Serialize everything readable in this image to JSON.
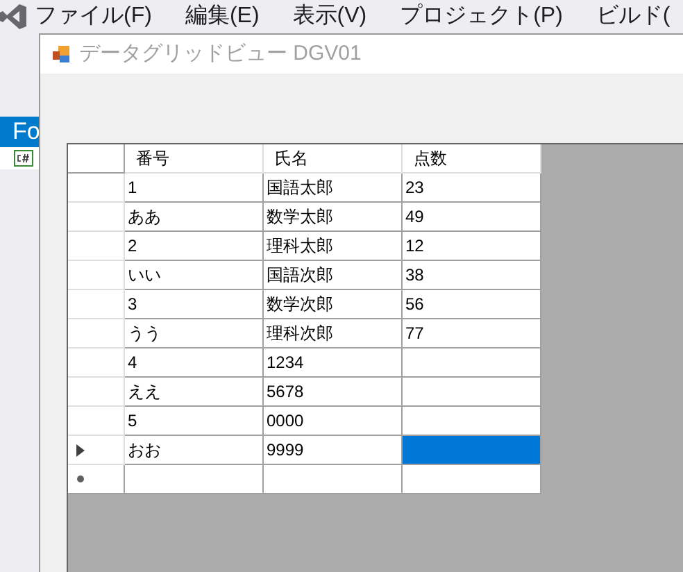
{
  "menu": [
    {
      "label": "ファイル(F)"
    },
    {
      "label": "編集(E)"
    },
    {
      "label": "表示(V)"
    },
    {
      "label": "プロジェクト(P)"
    },
    {
      "label": "ビルド("
    }
  ],
  "side_panel": {
    "tab": "Fo"
  },
  "window": {
    "title": "データグリッドビュー DGV01"
  },
  "grid": {
    "columns": [
      "番号",
      "氏名",
      "点数"
    ],
    "rows": [
      {
        "kind": "data",
        "current": false,
        "cells": [
          {
            "text": "1",
            "selected": false
          },
          {
            "text": "国語太郎",
            "selected": false
          },
          {
            "text": "23",
            "selected": false
          }
        ]
      },
      {
        "kind": "data",
        "current": false,
        "cells": [
          {
            "text": "ああ",
            "selected": false
          },
          {
            "text": "数学太郎",
            "selected": false
          },
          {
            "text": "49",
            "selected": false
          }
        ]
      },
      {
        "kind": "data",
        "current": false,
        "cells": [
          {
            "text": "2",
            "selected": false
          },
          {
            "text": "理科太郎",
            "selected": false
          },
          {
            "text": "12",
            "selected": false
          }
        ]
      },
      {
        "kind": "data",
        "current": false,
        "cells": [
          {
            "text": "いい",
            "selected": false
          },
          {
            "text": "国語次郎",
            "selected": false
          },
          {
            "text": "38",
            "selected": false
          }
        ]
      },
      {
        "kind": "data",
        "current": false,
        "cells": [
          {
            "text": "3",
            "selected": false
          },
          {
            "text": "数学次郎",
            "selected": false
          },
          {
            "text": "56",
            "selected": false
          }
        ]
      },
      {
        "kind": "data",
        "current": false,
        "cells": [
          {
            "text": "うう",
            "selected": false
          },
          {
            "text": "理科次郎",
            "selected": false
          },
          {
            "text": "77",
            "selected": false
          }
        ]
      },
      {
        "kind": "data",
        "current": false,
        "cells": [
          {
            "text": "4",
            "selected": false
          },
          {
            "text": "1234",
            "selected": false
          },
          {
            "selected": false
          }
        ]
      },
      {
        "kind": "data",
        "current": false,
        "cells": [
          {
            "text": "ええ",
            "selected": false
          },
          {
            "text": "5678",
            "selected": false
          },
          {
            "selected": false
          }
        ]
      },
      {
        "kind": "data",
        "current": false,
        "cells": [
          {
            "text": "5",
            "selected": false
          },
          {
            "text": "0000",
            "selected": false
          },
          {
            "selected": false
          }
        ]
      },
      {
        "kind": "data",
        "current": true,
        "cells": [
          {
            "text": "おお",
            "selected": false
          },
          {
            "text": "9999",
            "selected": false
          },
          {
            "selected": true
          }
        ]
      },
      {
        "kind": "new",
        "current": false,
        "cells": [
          {
            "selected": false
          },
          {
            "selected": false
          },
          {
            "selected": false
          }
        ]
      }
    ]
  }
}
